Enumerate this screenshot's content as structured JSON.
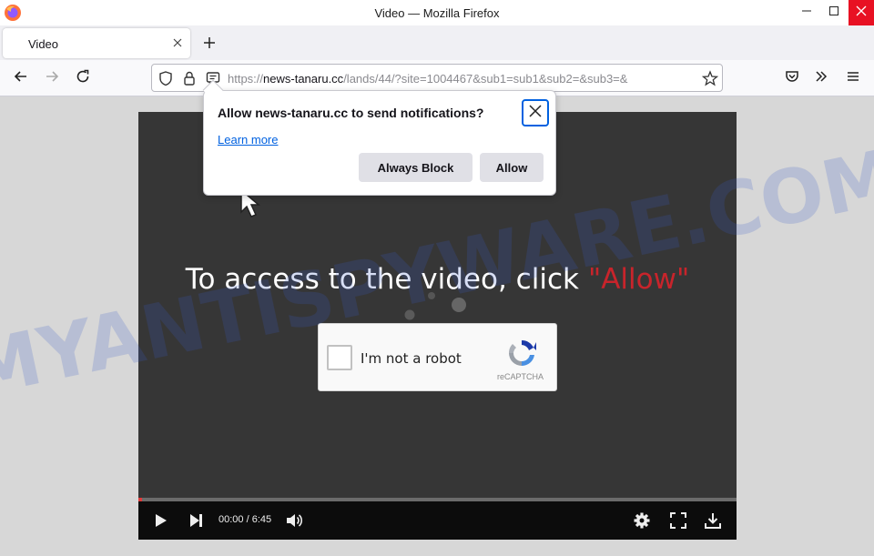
{
  "window": {
    "title": "Video — Mozilla Firefox"
  },
  "tabs": [
    {
      "label": "Video"
    }
  ],
  "navbar": {
    "url_prefix": "https://",
    "url_host": "news-tanaru.cc",
    "url_path": "/lands/44/?site=1004467&sub1=sub1&sub2=&sub3=&"
  },
  "notification": {
    "message": "Allow news-tanaru.cc to send notifications?",
    "learn_more": "Learn more",
    "block_label": "Always Block",
    "allow_label": "Allow"
  },
  "page": {
    "headline": "To access to the video, click",
    "headline_highlight": "\"Allow\"",
    "captcha_label": "I'm not a robot",
    "captcha_brand": "reCAPTCHA"
  },
  "player": {
    "time": "00:00 / 6:45",
    "progress_fraction": 0.0
  },
  "watermark": {
    "text": "MYANTISPYWARE.COM"
  },
  "colors": {
    "firefox_accent": "#0061e0",
    "highlight_red": "#c8242b",
    "close_red": "#e81123"
  },
  "icons": [
    "firefox-logo-icon",
    "minimize-icon",
    "maximize-icon",
    "close-icon",
    "tab-close-icon",
    "new-tab-icon",
    "back-icon",
    "forward-icon",
    "reload-icon",
    "shield-icon",
    "lock-icon",
    "notification-permission-icon",
    "bookmark-star-icon",
    "pocket-icon",
    "overflow-icon",
    "hamburger-menu-icon",
    "play-icon",
    "next-icon",
    "volume-icon",
    "settings-icon",
    "fullscreen-icon",
    "download-icon",
    "recaptcha-logo-icon",
    "mouse-cursor-icon"
  ]
}
